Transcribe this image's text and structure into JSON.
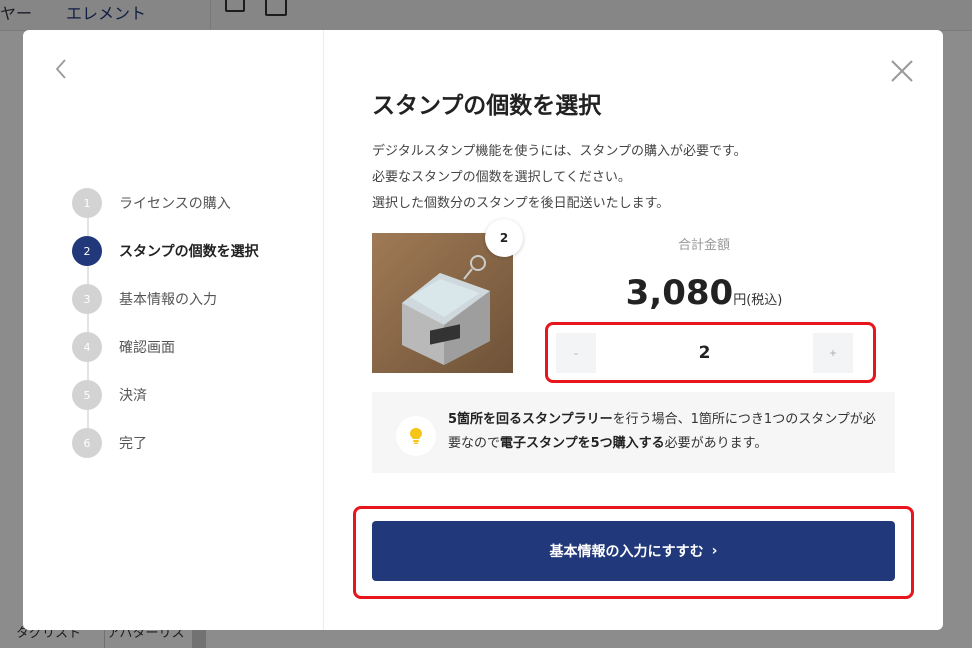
{
  "background_app": {
    "tab_layer": "ヤー",
    "tab_element": "エレメント",
    "bottom_tab1": "タグリスト",
    "bottom_tab2": "アバターリス"
  },
  "modal": {
    "title": "スタンプの個数を選択",
    "description": [
      "デジタルスタンプ機能を使うには、スタンプの購入が必要です。",
      "必要なスタンプの個数を選択してください。",
      "選択した個数分のスタンプを後日配送いたします。"
    ],
    "steps": [
      {
        "num": "1",
        "label": "ライセンスの購入",
        "active": false
      },
      {
        "num": "2",
        "label": "スタンプの個数を選択",
        "active": true
      },
      {
        "num": "3",
        "label": "基本情報の入力",
        "active": false
      },
      {
        "num": "4",
        "label": "確認画面",
        "active": false
      },
      {
        "num": "5",
        "label": "決済",
        "active": false
      },
      {
        "num": "6",
        "label": "完了",
        "active": false
      }
    ],
    "product": {
      "badge": "2"
    },
    "total": {
      "label": "合計金額",
      "price": "3,080",
      "unit": "円(税込)"
    },
    "quantity": {
      "minus": "-",
      "value": "2",
      "plus": "+"
    },
    "note": {
      "part1_bold": "5箇所を回るスタンプラリー",
      "part2": "を行う場合、1箇所につき1つのスタンプが必要なので",
      "part3_bold": "電子スタンプを5つ購入する",
      "part4": "必要があります。"
    },
    "next_button": {
      "label": "基本情報の入力にすすむ",
      "chevron": "›"
    }
  },
  "colors": {
    "primary": "#21397a",
    "highlight": "#e8161c",
    "step_inactive": "#d3d3d3"
  }
}
